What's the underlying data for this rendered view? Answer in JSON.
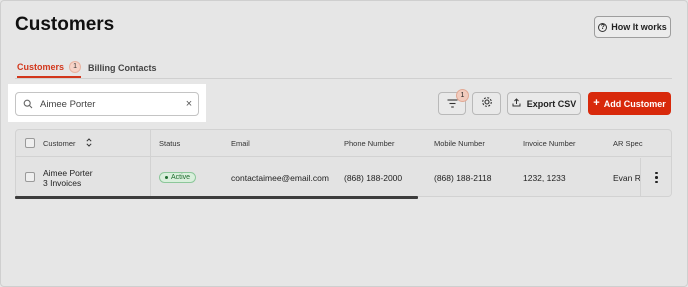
{
  "header": {
    "title": "Customers",
    "how_it_works_label": "How It works"
  },
  "tabs": [
    {
      "label": "Customers",
      "count": "1",
      "active": true
    },
    {
      "label": "Billing Contacts",
      "active": false
    }
  ],
  "search": {
    "value": "Aimee Porter",
    "placeholder": "Search"
  },
  "toolbar": {
    "filter_count": "1",
    "export_label": "Export CSV",
    "add_label": "Add Customer",
    "add_color": "#d8290b"
  },
  "table": {
    "columns": [
      "Customer",
      "Status",
      "Email",
      "Phone Number",
      "Mobile Number",
      "Invoice Number",
      "AR Spec"
    ],
    "rows": [
      {
        "customer_name": "Aimee Porter",
        "customer_sub": "3 Invoices",
        "status": "Active",
        "email": "contactaimee@email.com",
        "phone": "(868) 188-2000",
        "mobile": "(868) 188-2118",
        "invoice": "1232, 1233",
        "ar_spec": "Evan Ri"
      }
    ]
  },
  "colors": {
    "accent": "#d2371c",
    "status_active": "#1e6b2e"
  }
}
